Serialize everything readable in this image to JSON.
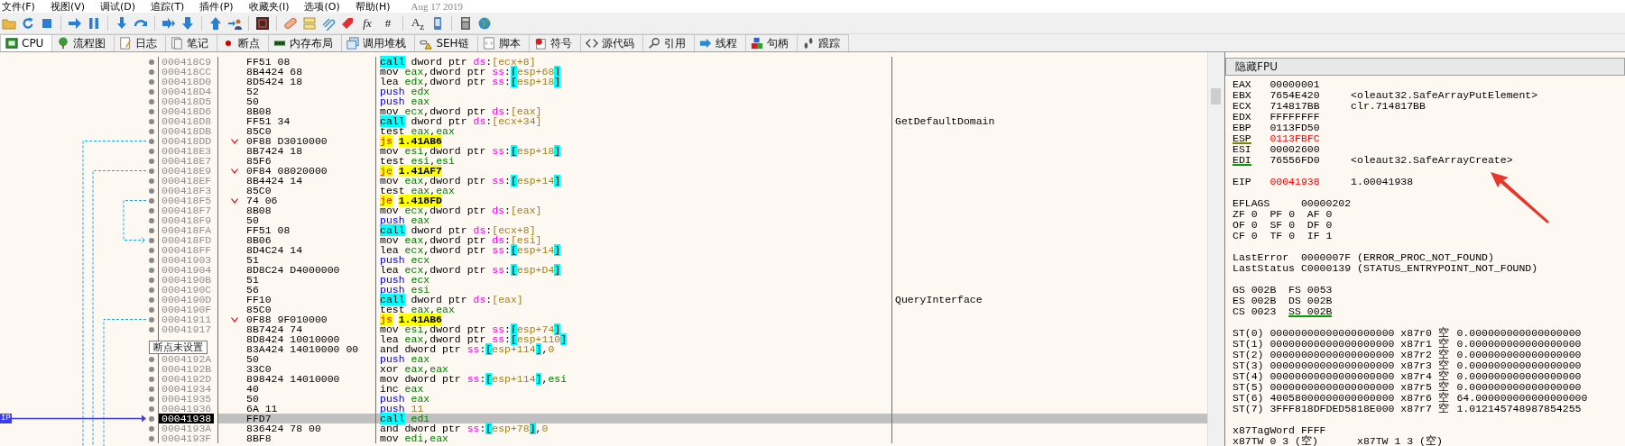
{
  "menu": [
    "文件(F)",
    "视图(V)",
    "调试(D)",
    "追踪(T)",
    "插件(P)",
    "收藏夹(I)",
    "选项(O)",
    "帮助(H)"
  ],
  "build_date": "Aug 17 2019",
  "toolbar_text": [
    "*fx*",
    "#",
    "A$_{z}$"
  ],
  "tabs": [
    {
      "label": "CPU",
      "selected": true
    },
    {
      "label": "流程图",
      "selected": false
    },
    {
      "label": "日志",
      "selected": false
    },
    {
      "label": "笔记",
      "selected": false
    },
    {
      "label": "断点",
      "selected": false
    },
    {
      "label": "内存布局",
      "selected": false
    },
    {
      "label": "调用堆栈",
      "selected": false
    },
    {
      "label": "SEH链",
      "selected": false
    },
    {
      "label": "脚本",
      "selected": false
    },
    {
      "label": "符号",
      "selected": false
    },
    {
      "label": "源代码",
      "selected": false
    },
    {
      "label": "引用",
      "selected": false
    },
    {
      "label": "线程",
      "selected": false
    },
    {
      "label": "句柄",
      "selected": false
    },
    {
      "label": "跟踪",
      "selected": false
    }
  ],
  "ip_label": "IP",
  "tooltip": "断点未设置",
  "rows": [
    {
      "address": "000418C9",
      "bytes": "FF51 08",
      "jump": false,
      "current": false,
      "instruction": [
        {
          "kind": "call",
          "text": "call"
        },
        {
          "kind": "op",
          "text": " dword ptr "
        },
        {
          "kind": "seg",
          "text": "ds"
        },
        {
          "kind": "op",
          "text": ":"
        },
        {
          "kind": "mem",
          "text": "[ecx+8]"
        }
      ]
    },
    {
      "address": "000418CC",
      "bytes": "8B4424 68",
      "jump": false,
      "current": false,
      "instruction": [
        {
          "kind": "op",
          "text": "mov "
        },
        {
          "kind": "reg",
          "text": "eax"
        },
        {
          "kind": "op",
          "text": ",dword ptr "
        },
        {
          "kind": "seg",
          "text": "ss"
        },
        {
          "kind": "op",
          "text": ":"
        },
        {
          "kind": "bracket",
          "text": "["
        },
        {
          "kind": "mem",
          "text": "esp+68"
        },
        {
          "kind": "bracket",
          "text": "]"
        }
      ]
    },
    {
      "address": "000418D0",
      "bytes": "8D5424 18",
      "jump": false,
      "current": false,
      "instruction": [
        {
          "kind": "op",
          "text": "lea "
        },
        {
          "kind": "reg",
          "text": "edx"
        },
        {
          "kind": "op",
          "text": ",dword ptr "
        },
        {
          "kind": "seg",
          "text": "ss"
        },
        {
          "kind": "op",
          "text": ":"
        },
        {
          "kind": "bracket",
          "text": "["
        },
        {
          "kind": "mem",
          "text": "esp+18"
        },
        {
          "kind": "bracket",
          "text": "]"
        }
      ]
    },
    {
      "address": "000418D4",
      "bytes": "52",
      "jump": false,
      "current": false,
      "instruction": [
        {
          "kind": "push",
          "text": "push "
        },
        {
          "kind": "reg",
          "text": "edx"
        }
      ]
    },
    {
      "address": "000418D5",
      "bytes": "50",
      "jump": false,
      "current": false,
      "instruction": [
        {
          "kind": "push",
          "text": "push "
        },
        {
          "kind": "reg",
          "text": "eax"
        }
      ]
    },
    {
      "address": "000418D6",
      "bytes": "8B08",
      "jump": false,
      "current": false,
      "instruction": [
        {
          "kind": "op",
          "text": "mov "
        },
        {
          "kind": "reg",
          "text": "ecx"
        },
        {
          "kind": "op",
          "text": ",dword ptr "
        },
        {
          "kind": "seg",
          "text": "ds"
        },
        {
          "kind": "op",
          "text": ":"
        },
        {
          "kind": "mem",
          "text": "[eax]"
        }
      ]
    },
    {
      "address": "000418D8",
      "bytes": "FF51 34",
      "jump": false,
      "current": false,
      "comment": "GetDefaultDomain",
      "instruction": [
        {
          "kind": "call",
          "text": "call"
        },
        {
          "kind": "op",
          "text": " dword ptr "
        },
        {
          "kind": "seg",
          "text": "ds"
        },
        {
          "kind": "op",
          "text": ":"
        },
        {
          "kind": "mem",
          "text": "[ecx+34]"
        }
      ]
    },
    {
      "address": "000418DB",
      "bytes": "85C0",
      "jump": false,
      "current": false,
      "instruction": [
        {
          "kind": "op",
          "text": "test "
        },
        {
          "kind": "reg",
          "text": "eax"
        },
        {
          "kind": "op",
          "text": ","
        },
        {
          "kind": "reg",
          "text": "eax"
        }
      ]
    },
    {
      "address": "000418DD",
      "bytes": "0F88 D3010000",
      "jump": true,
      "current": false,
      "instruction": [
        {
          "kind": "jcc",
          "text": "js"
        },
        {
          "kind": "target",
          "text": "1.41AB6"
        }
      ]
    },
    {
      "address": "000418E3",
      "bytes": "8B7424 18",
      "jump": false,
      "current": false,
      "instruction": [
        {
          "kind": "op",
          "text": "mov "
        },
        {
          "kind": "reg",
          "text": "esi"
        },
        {
          "kind": "op",
          "text": ",dword ptr "
        },
        {
          "kind": "seg",
          "text": "ss"
        },
        {
          "kind": "op",
          "text": ":"
        },
        {
          "kind": "bracket",
          "text": "["
        },
        {
          "kind": "mem",
          "text": "esp+18"
        },
        {
          "kind": "bracket",
          "text": "]"
        }
      ]
    },
    {
      "address": "000418E7",
      "bytes": "85F6",
      "jump": false,
      "current": false,
      "instruction": [
        {
          "kind": "op",
          "text": "test "
        },
        {
          "kind": "reg",
          "text": "esi"
        },
        {
          "kind": "op",
          "text": ","
        },
        {
          "kind": "reg",
          "text": "esi"
        }
      ]
    },
    {
      "address": "000418E9",
      "bytes": "0F84 08020000",
      "jump": true,
      "current": false,
      "instruction": [
        {
          "kind": "jcc",
          "text": "je"
        },
        {
          "kind": "target",
          "text": "1.41AF7"
        }
      ]
    },
    {
      "address": "000418EF",
      "bytes": "8B4424 14",
      "jump": false,
      "current": false,
      "instruction": [
        {
          "kind": "op",
          "text": "mov "
        },
        {
          "kind": "reg",
          "text": "eax"
        },
        {
          "kind": "op",
          "text": ",dword ptr "
        },
        {
          "kind": "seg",
          "text": "ss"
        },
        {
          "kind": "op",
          "text": ":"
        },
        {
          "kind": "bracket",
          "text": "["
        },
        {
          "kind": "mem",
          "text": "esp+14"
        },
        {
          "kind": "bracket",
          "text": "]"
        }
      ]
    },
    {
      "address": "000418F3",
      "bytes": "85C0",
      "jump": false,
      "current": false,
      "instruction": [
        {
          "kind": "op",
          "text": "test "
        },
        {
          "kind": "reg",
          "text": "eax"
        },
        {
          "kind": "op",
          "text": ","
        },
        {
          "kind": "reg",
          "text": "eax"
        }
      ]
    },
    {
      "address": "000418F5",
      "bytes": "74 06",
      "jump": true,
      "current": false,
      "instruction": [
        {
          "kind": "jcc",
          "text": "je"
        },
        {
          "kind": "target",
          "text": "1.418FD"
        }
      ]
    },
    {
      "address": "000418F7",
      "bytes": "8B08",
      "jump": false,
      "current": false,
      "instruction": [
        {
          "kind": "op",
          "text": "mov "
        },
        {
          "kind": "reg",
          "text": "ecx"
        },
        {
          "kind": "op",
          "text": ",dword ptr "
        },
        {
          "kind": "seg",
          "text": "ds"
        },
        {
          "kind": "op",
          "text": ":"
        },
        {
          "kind": "mem",
          "text": "[eax]"
        }
      ]
    },
    {
      "address": "000418F9",
      "bytes": "50",
      "jump": false,
      "current": false,
      "instruction": [
        {
          "kind": "push",
          "text": "push "
        },
        {
          "kind": "reg",
          "text": "eax"
        }
      ]
    },
    {
      "address": "000418FA",
      "bytes": "FF51 08",
      "jump": false,
      "current": false,
      "instruction": [
        {
          "kind": "call",
          "text": "call"
        },
        {
          "kind": "op",
          "text": " dword ptr "
        },
        {
          "kind": "seg",
          "text": "ds"
        },
        {
          "kind": "op",
          "text": ":"
        },
        {
          "kind": "mem",
          "text": "[ecx+8]"
        }
      ]
    },
    {
      "address": "000418FD",
      "bytes": "8B06",
      "jump": false,
      "current": false,
      "instruction": [
        {
          "kind": "op",
          "text": "mov "
        },
        {
          "kind": "reg",
          "text": "eax"
        },
        {
          "kind": "op",
          "text": ",dword ptr "
        },
        {
          "kind": "seg",
          "text": "ds"
        },
        {
          "kind": "op",
          "text": ":"
        },
        {
          "kind": "mem",
          "text": "[esi]"
        }
      ]
    },
    {
      "address": "000418FF",
      "bytes": "8D4C24 14",
      "jump": false,
      "current": false,
      "instruction": [
        {
          "kind": "op",
          "text": "lea "
        },
        {
          "kind": "reg",
          "text": "ecx"
        },
        {
          "kind": "op",
          "text": ",dword ptr "
        },
        {
          "kind": "seg",
          "text": "ss"
        },
        {
          "kind": "op",
          "text": ":"
        },
        {
          "kind": "bracket",
          "text": "["
        },
        {
          "kind": "mem",
          "text": "esp+14"
        },
        {
          "kind": "bracket",
          "text": "]"
        }
      ]
    },
    {
      "address": "00041903",
      "bytes": "51",
      "jump": false,
      "current": false,
      "instruction": [
        {
          "kind": "push",
          "text": "push "
        },
        {
          "kind": "reg",
          "text": "ecx"
        }
      ]
    },
    {
      "address": "00041904",
      "bytes": "8D8C24 D4000000",
      "jump": false,
      "current": false,
      "instruction": [
        {
          "kind": "op",
          "text": "lea "
        },
        {
          "kind": "reg",
          "text": "ecx"
        },
        {
          "kind": "op",
          "text": ",dword ptr "
        },
        {
          "kind": "seg",
          "text": "ss"
        },
        {
          "kind": "op",
          "text": ":"
        },
        {
          "kind": "bracket",
          "text": "["
        },
        {
          "kind": "mem",
          "text": "esp+D4"
        },
        {
          "kind": "bracket",
          "text": "]"
        }
      ]
    },
    {
      "address": "0004190B",
      "bytes": "51",
      "jump": false,
      "current": false,
      "instruction": [
        {
          "kind": "push",
          "text": "push "
        },
        {
          "kind": "reg",
          "text": "ecx"
        }
      ]
    },
    {
      "address": "0004190C",
      "bytes": "56",
      "jump": false,
      "current": false,
      "instruction": [
        {
          "kind": "push",
          "text": "push "
        },
        {
          "kind": "reg",
          "text": "esi"
        }
      ]
    },
    {
      "address": "0004190D",
      "bytes": "FF10",
      "jump": false,
      "current": false,
      "comment": "QueryInterface",
      "instruction": [
        {
          "kind": "call",
          "text": "call"
        },
        {
          "kind": "op",
          "text": " dword ptr "
        },
        {
          "kind": "seg",
          "text": "ds"
        },
        {
          "kind": "op",
          "text": ":"
        },
        {
          "kind": "mem",
          "text": "[eax]"
        }
      ]
    },
    {
      "address": "0004190F",
      "bytes": "85C0",
      "jump": false,
      "current": false,
      "instruction": [
        {
          "kind": "op",
          "text": "test "
        },
        {
          "kind": "reg",
          "text": "eax"
        },
        {
          "kind": "op",
          "text": ","
        },
        {
          "kind": "reg",
          "text": "eax"
        }
      ]
    },
    {
      "address": "00041911",
      "bytes": "0F88 9F010000",
      "jump": true,
      "current": false,
      "instruction": [
        {
          "kind": "jcc",
          "text": "js"
        },
        {
          "kind": "target",
          "text": "1.41AB6"
        }
      ]
    },
    {
      "address": "00041917",
      "bytes": "8B7424 74",
      "jump": false,
      "current": false,
      "instruction": [
        {
          "kind": "op",
          "text": "mov "
        },
        {
          "kind": "reg",
          "text": "esi"
        },
        {
          "kind": "op",
          "text": ",dword ptr "
        },
        {
          "kind": "seg",
          "text": "ss"
        },
        {
          "kind": "op",
          "text": ":"
        },
        {
          "kind": "bracket",
          "text": "["
        },
        {
          "kind": "mem",
          "text": "esp+74"
        },
        {
          "kind": "bracket",
          "text": "]"
        }
      ]
    },
    {
      "bytes": "8D8424 10010000",
      "jump": false,
      "current": false,
      "instruction": [
        {
          "kind": "op",
          "text": "lea "
        },
        {
          "kind": "reg",
          "text": "eax"
        },
        {
          "kind": "op",
          "text": ",dword ptr "
        },
        {
          "kind": "seg",
          "text": "ss"
        },
        {
          "kind": "op",
          "text": ":"
        },
        {
          "kind": "bracket",
          "text": "["
        },
        {
          "kind": "mem",
          "text": "esp+110"
        },
        {
          "kind": "bracket",
          "text": "]"
        }
      ]
    },
    {
      "bytes": "83A424 14010000 00",
      "jump": false,
      "current": false,
      "instruction": [
        {
          "kind": "op",
          "text": "and dword ptr "
        },
        {
          "kind": "seg",
          "text": "ss"
        },
        {
          "kind": "op",
          "text": ":"
        },
        {
          "kind": "bracket",
          "text": "["
        },
        {
          "kind": "mem",
          "text": "esp+114"
        },
        {
          "kind": "bracket",
          "text": "]"
        },
        {
          "kind": "op",
          "text": ","
        },
        {
          "kind": "num",
          "text": "0"
        }
      ]
    },
    {
      "address": "0004192A",
      "bytes": "50",
      "jump": false,
      "current": false,
      "instruction": [
        {
          "kind": "push",
          "text": "push "
        },
        {
          "kind": "reg",
          "text": "eax"
        }
      ]
    },
    {
      "address": "0004192B",
      "bytes": "33C0",
      "jump": false,
      "current": false,
      "instruction": [
        {
          "kind": "op",
          "text": "xor "
        },
        {
          "kind": "reg",
          "text": "eax"
        },
        {
          "kind": "op",
          "text": ","
        },
        {
          "kind": "reg",
          "text": "eax"
        }
      ]
    },
    {
      "address": "0004192D",
      "bytes": "898424 14010000",
      "jump": false,
      "current": false,
      "instruction": [
        {
          "kind": "op",
          "text": "mov dword ptr "
        },
        {
          "kind": "seg",
          "text": "ss"
        },
        {
          "kind": "op",
          "text": ":"
        },
        {
          "kind": "bracket",
          "text": "["
        },
        {
          "kind": "mem",
          "text": "esp+114"
        },
        {
          "kind": "bracket",
          "text": "]"
        },
        {
          "kind": "op",
          "text": ","
        },
        {
          "kind": "reg",
          "text": "esi"
        }
      ]
    },
    {
      "address": "00041934",
      "bytes": "40",
      "jump": false,
      "current": false,
      "instruction": [
        {
          "kind": "op",
          "text": "inc "
        },
        {
          "kind": "reg",
          "text": "eax"
        }
      ]
    },
    {
      "address": "00041935",
      "bytes": "50",
      "jump": false,
      "current": false,
      "instruction": [
        {
          "kind": "push",
          "text": "push "
        },
        {
          "kind": "reg",
          "text": "eax"
        }
      ]
    },
    {
      "address": "00041936",
      "bytes": "6A 11",
      "jump": false,
      "current": false,
      "instruction": [
        {
          "kind": "push",
          "text": "push "
        },
        {
          "kind": "num",
          "text": "11"
        }
      ]
    },
    {
      "address": "00041938",
      "bytes": "FFD7",
      "jump": false,
      "current": true,
      "instruction": [
        {
          "kind": "call",
          "text": "call"
        },
        {
          "kind": "reg",
          "text": "edi"
        }
      ]
    },
    {
      "address": "0004193A",
      "bytes": "836424 78 00",
      "jump": false,
      "current": false,
      "instruction": [
        {
          "kind": "op",
          "text": "and dword ptr "
        },
        {
          "kind": "seg",
          "text": "ss"
        },
        {
          "kind": "op",
          "text": ":"
        },
        {
          "kind": "bracket",
          "text": "["
        },
        {
          "kind": "mem",
          "text": "esp+78"
        },
        {
          "kind": "bracket",
          "text": "]"
        },
        {
          "kind": "op",
          "text": ","
        },
        {
          "kind": "num",
          "text": "0"
        }
      ]
    },
    {
      "address": "0004193F",
      "bytes": "8BF8",
      "jump": false,
      "current": false,
      "instruction": [
        {
          "kind": "op",
          "text": "mov "
        },
        {
          "kind": "reg",
          "text": "edi"
        },
        {
          "kind": "op",
          "text": ","
        },
        {
          "kind": "reg",
          "text": "eax"
        }
      ]
    }
  ],
  "fpu_button": "隐藏FPU",
  "registers": [
    {
      "name": "EAX",
      "value": "00000001",
      "changed": false
    },
    {
      "name": "EBX",
      "value": "7654E420",
      "changed": false,
      "comment": "<oleaut32.SafeArrayPutElement>"
    },
    {
      "name": "ECX",
      "value": "714817BB",
      "changed": false,
      "comment": "clr.714817BB"
    },
    {
      "name": "EDX",
      "value": "FFFFFFFF",
      "changed": false
    },
    {
      "name": "EBP",
      "value": "0113FD50",
      "changed": false
    },
    {
      "name": "ESP",
      "value": "0113FBFC",
      "changed": true,
      "color": "#808000"
    },
    {
      "name": "ESI",
      "value": "00002600",
      "changed": false
    },
    {
      "name": "EDI",
      "value": "76556FD0",
      "changed": false,
      "color": "#00a000",
      "comment": "<oleaut32.SafeArrayCreate>"
    }
  ],
  "eip": {
    "name": "EIP",
    "value": "00041938",
    "changed": true,
    "comment": "1.00041938"
  },
  "eflags": {
    "name": "EFLAGS",
    "value": "00000202"
  },
  "flags": [
    [
      {
        "name": "ZF",
        "value": "0"
      },
      {
        "name": "PF",
        "value": "0"
      },
      {
        "name": "AF",
        "value": "0"
      }
    ],
    [
      {
        "name": "OF",
        "value": "0"
      },
      {
        "name": "SF",
        "value": "0"
      },
      {
        "name": "DF",
        "value": "0"
      }
    ],
    [
      {
        "name": "CF",
        "value": "0"
      },
      {
        "name": "TF",
        "value": "0"
      },
      {
        "name": "IF",
        "value": "1"
      }
    ]
  ],
  "last": [
    {
      "name": "LastError",
      "value": "0000007F",
      "description": "(ERROR_PROC_NOT_FOUND)"
    },
    {
      "name": "LastStatus",
      "value": "C0000139",
      "description": "(STATUS_ENTRYPOINT_NOT_FOUND)"
    }
  ],
  "segments": [
    [
      {
        "name": "GS",
        "value": "002B"
      },
      {
        "name": "FS",
        "value": "0053"
      }
    ],
    [
      {
        "name": "ES",
        "value": "002B"
      },
      {
        "name": "DS",
        "value": "002B"
      }
    ],
    [
      {
        "name": "CS",
        "value": "0023"
      },
      {
        "name": "SS",
        "value": "002B",
        "color": "#00a000"
      }
    ]
  ],
  "fpu": [
    {
      "name": "ST(0)",
      "raw": "00000000000000000000",
      "reg": "x87r0",
      "tag": "空",
      "value": "0.000000000000000000"
    },
    {
      "name": "ST(1)",
      "raw": "00000000000000000000",
      "reg": "x87r1",
      "tag": "空",
      "value": "0.000000000000000000"
    },
    {
      "name": "ST(2)",
      "raw": "00000000000000000000",
      "reg": "x87r2",
      "tag": "空",
      "value": "0.000000000000000000"
    },
    {
      "name": "ST(3)",
      "raw": "00000000000000000000",
      "reg": "x87r3",
      "tag": "空",
      "value": "0.000000000000000000"
    },
    {
      "name": "ST(4)",
      "raw": "00000000000000000000",
      "reg": "x87r4",
      "tag": "空",
      "value": "0.000000000000000000"
    },
    {
      "name": "ST(5)",
      "raw": "00000000000000000000",
      "reg": "x87r5",
      "tag": "空",
      "value": "0.000000000000000000"
    },
    {
      "name": "ST(6)",
      "raw": "40058000000000000000",
      "reg": "x87r6",
      "tag": "空",
      "value": "64.000000000000000000"
    },
    {
      "name": "ST(7)",
      "raw": "3FFF818DFDED5818E000",
      "reg": "x87r7",
      "tag": "空",
      "value": "1.012145748987854255"
    }
  ],
  "tag_word": {
    "name": "x87TagWord",
    "value": "FFFF"
  },
  "tag_entries": [
    "x87TW 0 3 (空)",
    "x87TW 1 3 (空)"
  ]
}
